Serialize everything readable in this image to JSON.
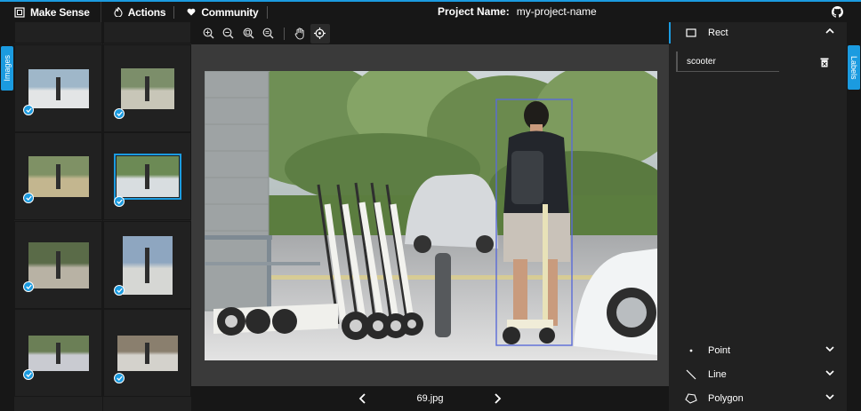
{
  "app": {
    "brand": "Make Sense",
    "nav": [
      {
        "label": "Actions",
        "icon": "flame-icon"
      },
      {
        "label": "Community",
        "icon": "heart-icon"
      }
    ],
    "project_label": "Project Name:",
    "project_name": "my-project-name"
  },
  "sidebars": {
    "left_tab": "Images",
    "right_tab": "Labels"
  },
  "gallery": {
    "thumbnails": [
      {
        "checked": true,
        "selected": false
      },
      {
        "checked": true,
        "selected": false
      },
      {
        "checked": true,
        "selected": false
      },
      {
        "checked": true,
        "selected": false
      },
      {
        "checked": true,
        "selected": false
      },
      {
        "checked": true,
        "selected": true
      },
      {
        "checked": true,
        "selected": false
      },
      {
        "checked": true,
        "selected": false
      },
      {
        "checked": true,
        "selected": false
      },
      {
        "checked": true,
        "selected": false
      }
    ]
  },
  "toolbar": {
    "tools": [
      "zoom-in-icon",
      "zoom-out-icon",
      "zoom-fit-icon",
      "zoom-max-icon",
      "hand-icon",
      "crosshair-icon"
    ]
  },
  "editor": {
    "file_name": "69.jpg",
    "annotation_label": "scooter"
  },
  "labels_panel": {
    "sections": [
      {
        "name": "Rect",
        "expanded": true
      },
      {
        "name": "Point",
        "expanded": false
      },
      {
        "name": "Line",
        "expanded": false
      },
      {
        "name": "Polygon",
        "expanded": false
      }
    ],
    "rect_labels": [
      "scooter"
    ]
  },
  "colors": {
    "accent": "#1b9be0",
    "bg_dark": "#171717",
    "panel": "#212121",
    "editor_bg": "#3a3a3a",
    "bbox": "#5a6bd8"
  }
}
